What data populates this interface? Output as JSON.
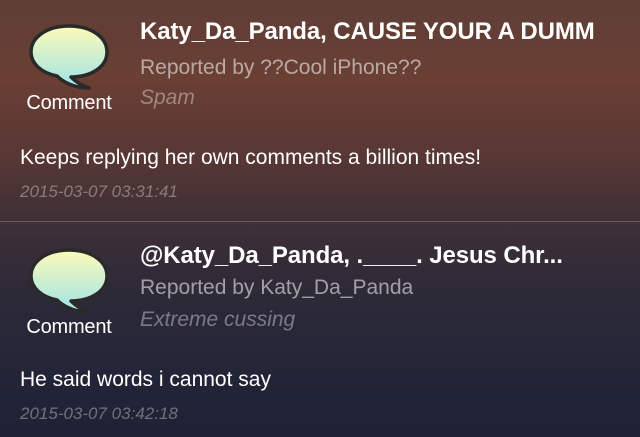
{
  "reports": [
    {
      "comment_label": "Comment",
      "title": "Katy_Da_Panda, CAUSE YOUR A DUMM",
      "reporter": "Reported by ??Cool iPhone??",
      "reason": "Spam",
      "message": "Keeps replying her own comments a billion times!",
      "timestamp": "2015-03-07 03:31:41"
    },
    {
      "comment_label": "Comment",
      "title": "@Katy_Da_Panda, .____. Jesus Chr...",
      "reporter": "Reported by Katy_Da_Panda",
      "reason": "Extreme cussing",
      "message": "He said words i cannot say",
      "timestamp": "2015-03-07 03:42:18"
    }
  ],
  "icons": {
    "comment": "speech-bubble-icon"
  },
  "colors": {
    "bubble_fill_top": "#fdfbb8",
    "bubble_fill_bottom": "#9fe3ea",
    "bubble_stroke": "#2a2a2a",
    "text_primary": "#ffffff"
  }
}
